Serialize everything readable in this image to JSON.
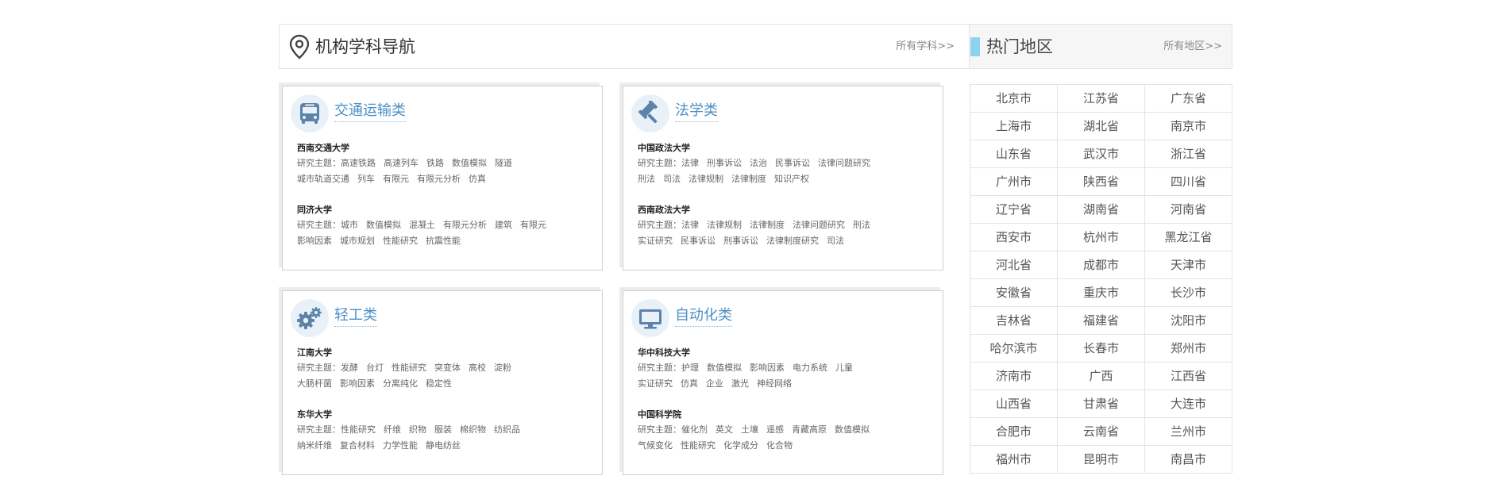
{
  "nav": {
    "title": "机构学科导航",
    "more": "所有学科>>"
  },
  "regions_panel": {
    "title": "热门地区",
    "more": "所有地区>>"
  },
  "cards": [
    {
      "title": "交通运输类",
      "icon": "bus-icon",
      "universities": [
        {
          "name": "西南交通大学",
          "topic_prefix": "研究主题：",
          "topics": [
            "高速铁路",
            "高速列车",
            "铁路",
            "数值模拟",
            "隧道"
          ],
          "topics_line2": [
            "城市轨道交通",
            "列车",
            "有限元",
            "有限元分析",
            "仿真"
          ]
        },
        {
          "name": "同济大学",
          "topic_prefix": "研究主题：",
          "topics": [
            "城市",
            "数值模拟",
            "混凝土",
            "有限元分析",
            "建筑",
            "有限元"
          ],
          "topics_line2": [
            "影响因素",
            "城市规划",
            "性能研究",
            "抗震性能"
          ]
        }
      ]
    },
    {
      "title": "法学类",
      "icon": "gavel-icon",
      "universities": [
        {
          "name": "中国政法大学",
          "topic_prefix": "研究主题：",
          "topics": [
            "法律",
            "刑事诉讼",
            "法治",
            "民事诉讼",
            "法律问题研究"
          ],
          "topics_line2": [
            "刑法",
            "司法",
            "法律规制",
            "法律制度",
            "知识产权"
          ]
        },
        {
          "name": "西南政法大学",
          "topic_prefix": "研究主题：",
          "topics": [
            "法律",
            "法律规制",
            "法律制度",
            "法律问题研究",
            "刑法"
          ],
          "topics_line2": [
            "实证研究",
            "民事诉讼",
            "刑事诉讼",
            "法律制度研究",
            "司法"
          ]
        }
      ]
    },
    {
      "title": "轻工类",
      "icon": "gears-icon",
      "universities": [
        {
          "name": "江南大学",
          "topic_prefix": "研究主题：",
          "topics": [
            "发酵",
            "台灯",
            "性能研究",
            "突变体",
            "高校",
            "淀粉"
          ],
          "topics_line2": [
            "大肠杆菌",
            "影响因素",
            "分离纯化",
            "稳定性"
          ]
        },
        {
          "name": "东华大学",
          "topic_prefix": "研究主题：",
          "topics": [
            "性能研究",
            "纤维",
            "织物",
            "服装",
            "棉织物",
            "纺织品"
          ],
          "topics_line2": [
            "纳米纤维",
            "复合材料",
            "力学性能",
            "静电纺丝"
          ]
        }
      ]
    },
    {
      "title": "自动化类",
      "icon": "monitor-icon",
      "universities": [
        {
          "name": "华中科技大学",
          "topic_prefix": "研究主题：",
          "topics": [
            "护理",
            "数值模拟",
            "影响因素",
            "电力系统",
            "儿童"
          ],
          "topics_line2": [
            "实证研究",
            "仿真",
            "企业",
            "激光",
            "神经网络"
          ]
        },
        {
          "name": "中国科学院",
          "topic_prefix": "研究主题：",
          "topics": [
            "催化剂",
            "英文",
            "土壤",
            "遥感",
            "青藏高原",
            "数值模拟"
          ],
          "topics_line2": [
            "气候变化",
            "性能研究",
            "化学成分",
            "化合物"
          ]
        }
      ]
    }
  ],
  "regions": [
    [
      "北京市",
      "江苏省",
      "广东省"
    ],
    [
      "上海市",
      "湖北省",
      "南京市"
    ],
    [
      "山东省",
      "武汉市",
      "浙江省"
    ],
    [
      "广州市",
      "陕西省",
      "四川省"
    ],
    [
      "辽宁省",
      "湖南省",
      "河南省"
    ],
    [
      "西安市",
      "杭州市",
      "黑龙江省"
    ],
    [
      "河北省",
      "成都市",
      "天津市"
    ],
    [
      "安徽省",
      "重庆市",
      "长沙市"
    ],
    [
      "吉林省",
      "福建省",
      "沈阳市"
    ],
    [
      "哈尔滨市",
      "长春市",
      "郑州市"
    ],
    [
      "济南市",
      "广西",
      "江西省"
    ],
    [
      "山西省",
      "甘肃省",
      "大连市"
    ],
    [
      "合肥市",
      "云南省",
      "兰州市"
    ],
    [
      "福州市",
      "昆明市",
      "南昌市"
    ]
  ],
  "colors": {
    "accent_blue": "#4b8fc6",
    "region_accent": "#8cd3f0",
    "icon_blue": "#5b84a8"
  }
}
